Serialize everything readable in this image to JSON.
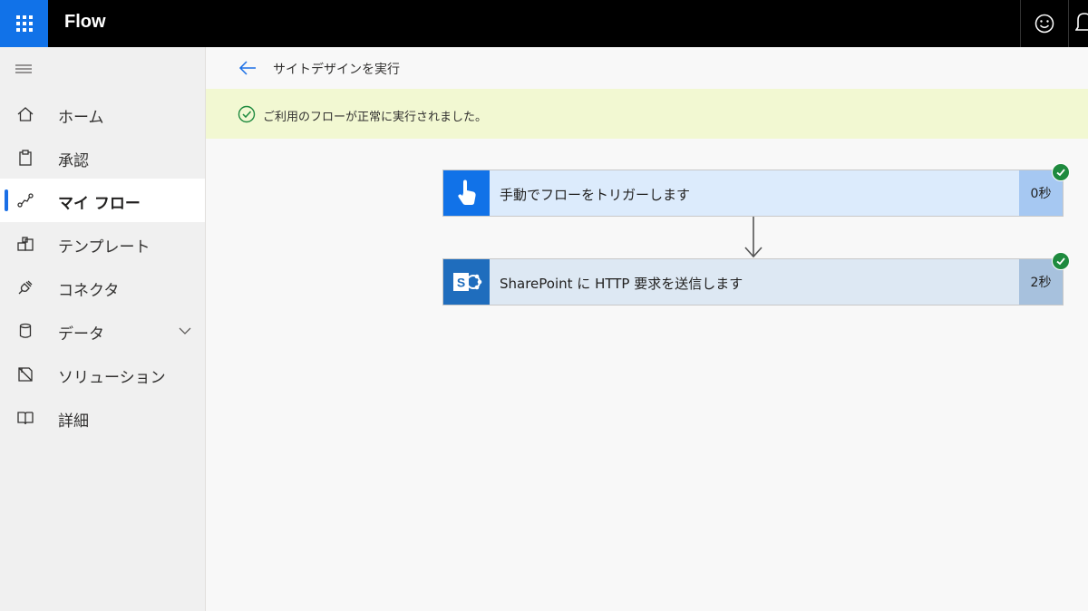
{
  "topbar": {
    "brand": "Flow",
    "waffle_icon": "waffle-icon",
    "feedback_icon": "smiley-icon",
    "notification_icon": "bell-icon"
  },
  "sidebar": {
    "menu_icon": "hamburger-icon",
    "items": [
      {
        "label": "ホーム",
        "icon": "home-icon",
        "active": false
      },
      {
        "label": "承認",
        "icon": "clipboard-icon",
        "active": false
      },
      {
        "label": "マイ フロー",
        "icon": "flow-icon",
        "active": true
      },
      {
        "label": "テンプレート",
        "icon": "template-icon",
        "active": false
      },
      {
        "label": "コネクタ",
        "icon": "connector-icon",
        "active": false
      },
      {
        "label": "データ",
        "icon": "database-icon",
        "active": false,
        "expandable": true
      },
      {
        "label": "ソリューション",
        "icon": "solution-icon",
        "active": false
      },
      {
        "label": "詳細",
        "icon": "book-icon",
        "active": false
      }
    ]
  },
  "header": {
    "title": "サイトデザインを実行"
  },
  "banner": {
    "message": "ご利用のフローが正常に実行されました。",
    "status": "success"
  },
  "flow": {
    "steps": [
      {
        "title": "手動でフローをトリガーします",
        "duration": "0秒",
        "icon": "touch-trigger-icon",
        "status": "succeeded"
      },
      {
        "title": "SharePoint に HTTP 要求を送信します",
        "duration": "2秒",
        "icon": "sharepoint-icon",
        "status": "succeeded"
      }
    ]
  },
  "colors": {
    "accent": "#1172e8",
    "success": "#1e8a3e",
    "banner_bg": "#f2f8d2"
  }
}
